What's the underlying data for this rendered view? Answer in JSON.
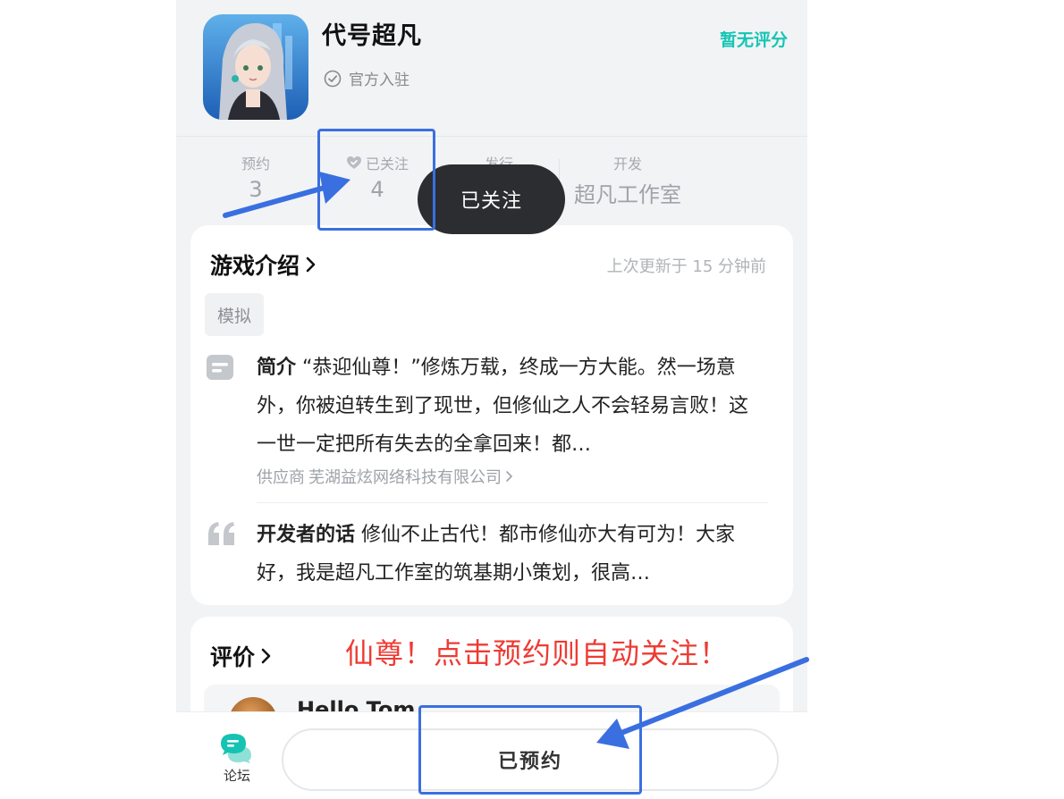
{
  "app": {
    "title": "代号超凡",
    "official_label": "官方入驻",
    "rating": "暂无评分"
  },
  "stats": {
    "booking": {
      "label": "预约",
      "value": "3"
    },
    "follow": {
      "label": "已关注",
      "value": "4"
    },
    "publish": {
      "label": "发行",
      "value": ""
    },
    "developer": {
      "label": "开发",
      "value": "超凡工作室"
    }
  },
  "toast": "已关注",
  "intro": {
    "title": "游戏介绍",
    "updated": "上次更新于 15 分钟前",
    "tag": "模拟",
    "desc_label": "简介",
    "desc_text": "“恭迎仙尊！”修炼万载，终成一方大能。然一场意外，你被迫转生到了现世，但修仙之人不会轻易言败！这一世一定把所有失去的全拿回来！都…",
    "supplier_label": "供应商",
    "supplier_name": "芜湖益炫网络科技有限公司",
    "devwords_label": "开发者的话",
    "devwords_text": "修仙不止古代！都市修仙亦大有可为！大家好，我是超凡工作室的筑基期小策划，很高…"
  },
  "review": {
    "title": "评价",
    "first_name": "Hello Tom"
  },
  "bottom": {
    "forum_label": "论坛",
    "reserved_label": "已预约"
  },
  "annotation": {
    "text": "仙尊！点击预约则自动关注！",
    "color": "#ee3b33",
    "box_color": "#3a6fe0"
  },
  "colors": {
    "accent": "#15c5b4",
    "toast_bg": "#2b2d30"
  }
}
